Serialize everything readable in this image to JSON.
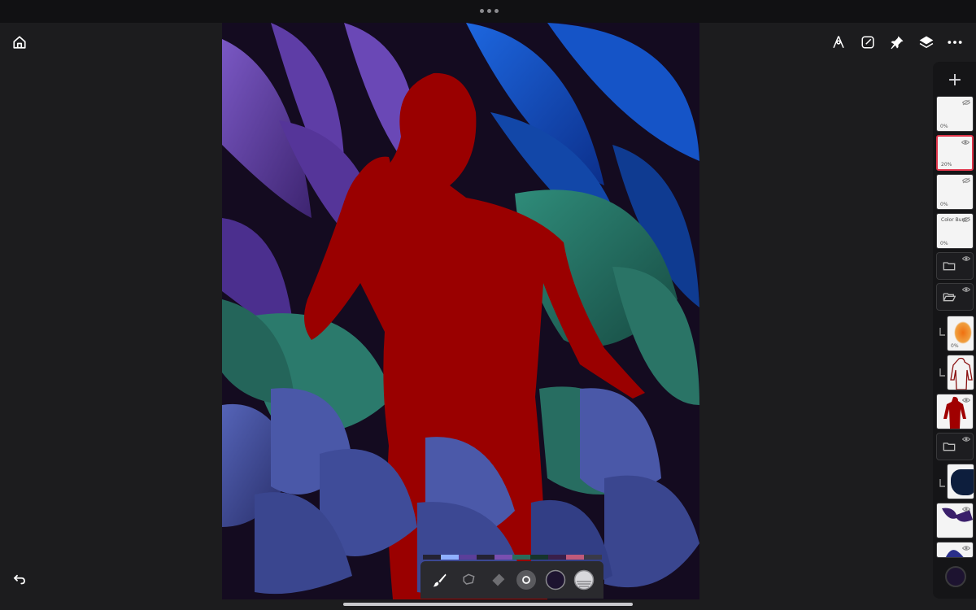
{
  "app": {
    "top_grabber": "more-options-handle",
    "accent": "#e0354b"
  },
  "header": {
    "left_icon": "home-icon",
    "right_icons": [
      "vector-pen-icon",
      "edit-square-icon",
      "pin-icon",
      "layers-icon",
      "more-icon"
    ]
  },
  "layers_panel": {
    "add_label": "+",
    "layers": [
      {
        "kind": "layer",
        "opacity": "0%",
        "name": "",
        "hidden": true
      },
      {
        "kind": "layer",
        "opacity": "20%",
        "name": "",
        "hidden": true,
        "selected": true
      },
      {
        "kind": "layer",
        "opacity": "0%",
        "name": "",
        "hidden": true
      },
      {
        "kind": "layer",
        "opacity": "0%",
        "name": "Color Burn",
        "hidden": true
      },
      {
        "kind": "group",
        "state": "closed"
      },
      {
        "kind": "group",
        "state": "open"
      },
      {
        "kind": "layer",
        "opacity": "0%",
        "name": "",
        "clipped": true
      },
      {
        "kind": "layer",
        "opacity": "",
        "name": "",
        "clipped": true
      },
      {
        "kind": "layer",
        "opacity": "",
        "name": ""
      },
      {
        "kind": "group",
        "state": "closed"
      },
      {
        "kind": "layer",
        "opacity": "",
        "name": "",
        "clipped": true
      },
      {
        "kind": "layer",
        "opacity": "",
        "name": ""
      },
      {
        "kind": "layer",
        "opacity": "",
        "name": ""
      }
    ],
    "current_color": "#1d1330"
  },
  "toolbar": {
    "tools": [
      "brush-icon",
      "lasso-icon",
      "eraser-icon",
      "brush-size-icon",
      "color-icon",
      "opacity-icon"
    ],
    "palette": [
      "#242233",
      "#8fb0ff",
      "#5b3f9a",
      "#242233",
      "#7a4fb0",
      "#2a6b5a",
      "#16342c",
      "#3a1f4a",
      "#c05a7a",
      "#3a3a48"
    ]
  },
  "footer": {
    "undo_icon": "undo-icon"
  }
}
